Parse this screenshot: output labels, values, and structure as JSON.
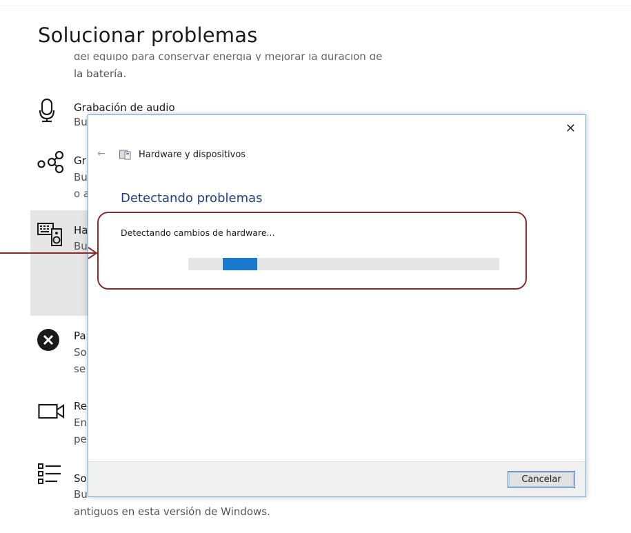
{
  "page": {
    "title": "Solucionar problemas",
    "cut_text": "del equipo para conservar energía y mejorar la duración de",
    "battery_tail": "la batería."
  },
  "items": [
    {
      "icon": "microphone-icon",
      "title": "Grabación de audio",
      "desc": [
        "Bu"
      ]
    },
    {
      "icon": "bluetooth-share-icon",
      "title": "Gr",
      "desc": [
        "Bu",
        "o a"
      ]
    },
    {
      "icon": "hardware-icon",
      "title": "Ha",
      "desc": [
        "Bu"
      ]
    },
    {
      "icon": "error-x-icon",
      "title": "Pa",
      "desc": [
        "So",
        "se"
      ]
    },
    {
      "icon": "video-camera-icon",
      "title": "Re",
      "desc": [
        "En",
        "pe"
      ]
    },
    {
      "icon": "list-icon",
      "title": "So",
      "desc": [
        "Bu"
      ]
    }
  ],
  "bottom_text": "antiguos en esta versión de Windows.",
  "dialog": {
    "close": "✕",
    "back": "←",
    "breadcrumb": "Hardware y dispositivos",
    "heading": "Detectando problemas",
    "status": "Detectando cambios de hardware...",
    "progress_state": "indeterminate",
    "cancel_label": "Cancelar"
  },
  "colors": {
    "accent": "#1979ca",
    "heading": "#1e3f8a",
    "annotation": "#8b2a2a"
  }
}
